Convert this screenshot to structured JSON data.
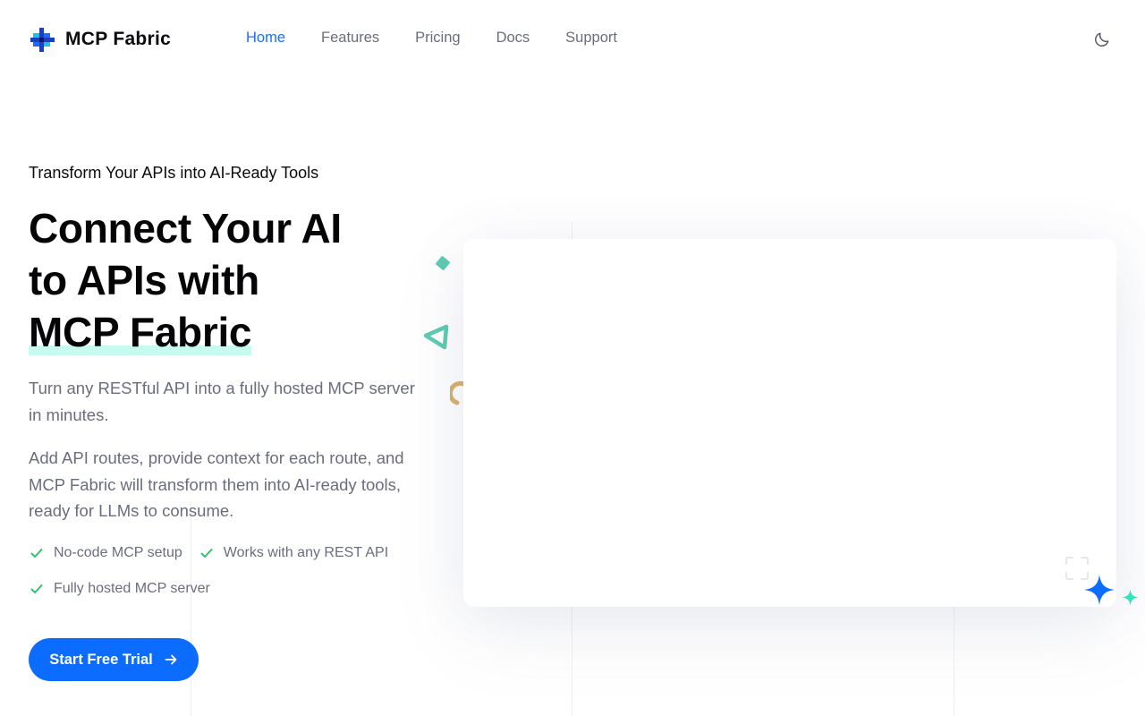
{
  "header": {
    "brand": "MCP Fabric",
    "nav": [
      {
        "label": "Home",
        "active": true
      },
      {
        "label": "Features",
        "active": false
      },
      {
        "label": "Pricing",
        "active": false
      },
      {
        "label": "Docs",
        "active": false
      },
      {
        "label": "Support",
        "active": false
      }
    ],
    "theme_icon": "moon-icon"
  },
  "hero": {
    "eyebrow": "Transform Your APIs into AI-Ready Tools",
    "headline_line1": "Connect Your AI",
    "headline_line2": "to APIs with",
    "headline_brand": "MCP Fabric",
    "paragraph1": "Turn any RESTful API into a fully hosted MCP server in minutes.",
    "paragraph2": "Add API routes, provide context for each route, and MCP Fabric will transform them into AI-ready tools, ready for LLMs to consume.",
    "features": [
      "No-code MCP setup",
      "Works with any REST API",
      "Fully hosted MCP server"
    ],
    "cta_label": "Start Free Trial"
  },
  "colors": {
    "accent": "#0b6cff",
    "nav_active": "#1a6dff",
    "check": "#22c55e",
    "highlight": "#c6fbef",
    "muted_text": "#6a6e7c"
  }
}
